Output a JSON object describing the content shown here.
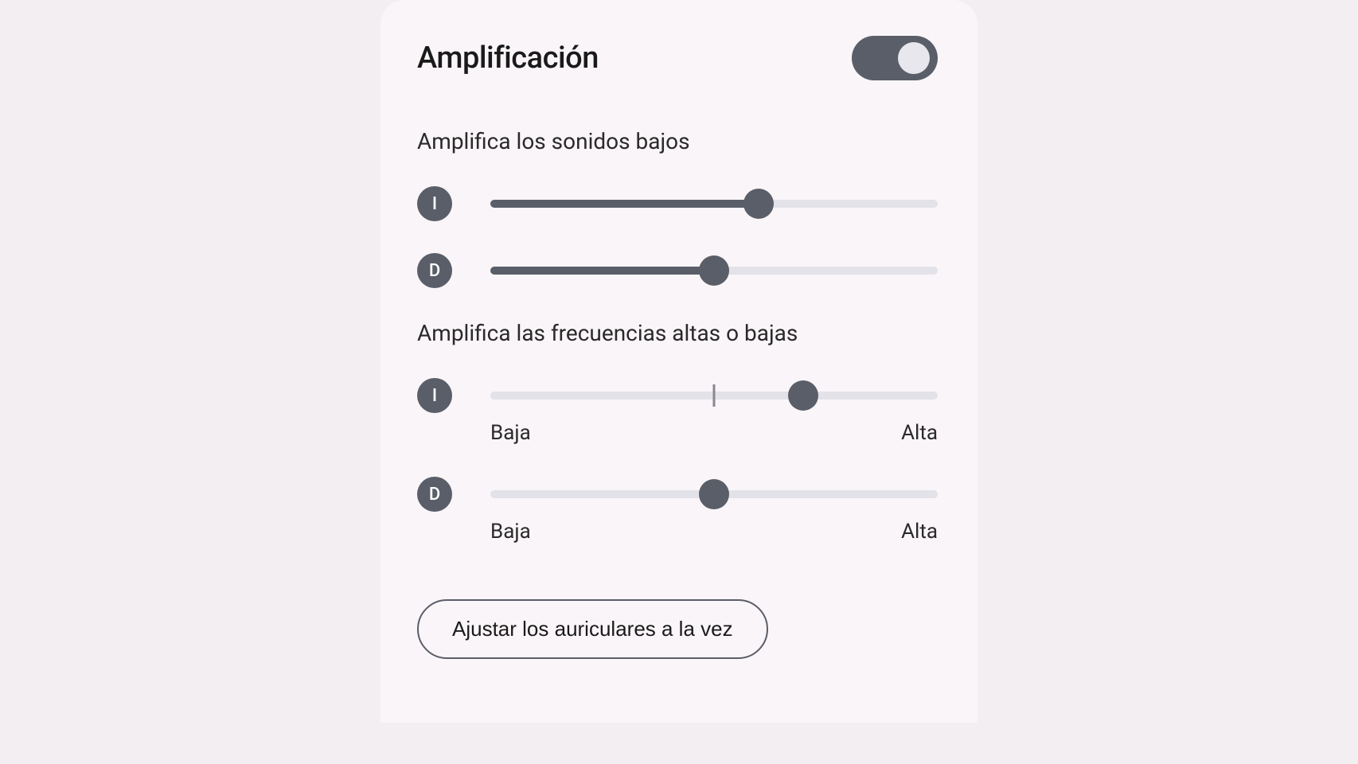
{
  "header": {
    "title": "Amplificación",
    "toggle_on": true
  },
  "sections": {
    "low_sounds": {
      "label": "Amplifica los sonidos bajos",
      "left": {
        "channel": "I",
        "value": 60
      },
      "right": {
        "channel": "D",
        "value": 50
      }
    },
    "frequencies": {
      "label": "Amplifica las frecuencias altas o bajas",
      "left": {
        "channel": "I",
        "value": 70,
        "low": "Baja",
        "high": "Alta"
      },
      "right": {
        "channel": "D",
        "value": 50,
        "low": "Baja",
        "high": "Alta"
      }
    }
  },
  "button": {
    "adjust_both": "Ajustar los auriculares a la vez"
  }
}
